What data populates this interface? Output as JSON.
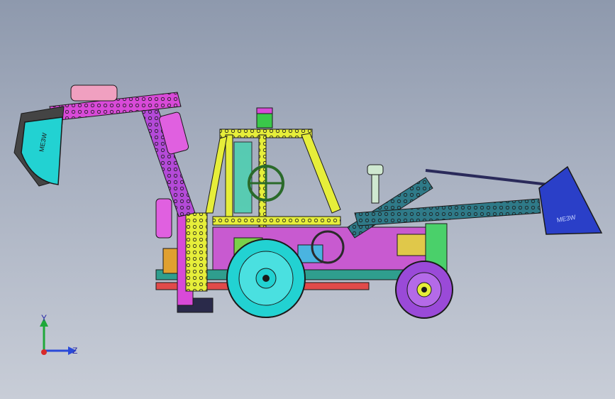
{
  "bucket_marks": {
    "backhoe_bucket": "ME3W",
    "loader_bucket": "ME3W"
  },
  "triad": {
    "y_label": "Y",
    "z_label": "Z"
  },
  "colors": {
    "background_top": "#8e99ad",
    "background_bottom": "#c8cdd7",
    "frame_yellow": "#e6ee3a",
    "arm_magenta": "#d84ad8",
    "loader_teal": "#2f7a88",
    "wheel_cyan": "#22d2d2",
    "wheel_purple": "#9a4ad8",
    "bucket_blue": "#2a3fc8",
    "outline": "#1a1a1a"
  }
}
